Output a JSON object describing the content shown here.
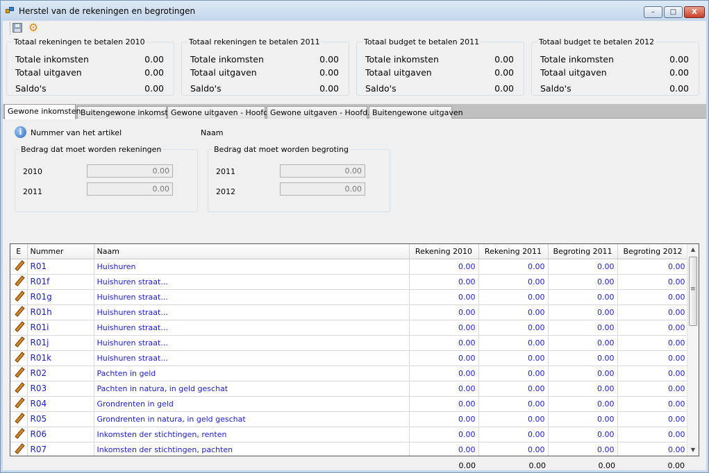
{
  "window": {
    "title": "Herstel van de rekeningen en begrotingen",
    "min": "–",
    "max": "□",
    "close": "X"
  },
  "toolbar": {
    "save_icon": "save-icon",
    "settings_icon": "gear-icon"
  },
  "summaries": [
    {
      "caption": "Totaal rekeningen te betalen 2010",
      "rows": [
        {
          "label": "Totale inkomsten",
          "value": "0.00"
        },
        {
          "label": "Totaal uitgaven",
          "value": "0.00"
        },
        {
          "label": "Saldo's",
          "value": "0.00"
        }
      ]
    },
    {
      "caption": "Totaal rekeningen te betalen 2011",
      "rows": [
        {
          "label": "Totale inkomsten",
          "value": "0.00"
        },
        {
          "label": "Totaal uitgaven",
          "value": "0.00"
        },
        {
          "label": "Saldo's",
          "value": "0.00"
        }
      ]
    },
    {
      "caption": "Totaal budget te betalen 2011",
      "rows": [
        {
          "label": "Totale inkomsten",
          "value": "0.00"
        },
        {
          "label": "Totaal uitgaven",
          "value": "0.00"
        },
        {
          "label": "Saldo's",
          "value": "0.00"
        }
      ]
    },
    {
      "caption": "Totaal budget te betalen 2012",
      "rows": [
        {
          "label": "Totale inkomsten",
          "value": "0.00"
        },
        {
          "label": "Totaal uitgaven",
          "value": "0.00"
        },
        {
          "label": "Saldo's",
          "value": "0.00"
        }
      ]
    }
  ],
  "tabs": [
    {
      "label": "Gewone inkomsten"
    },
    {
      "label": "Buitengewone inkomsten"
    },
    {
      "label": "Gewone uitgaven - Hoofd. I"
    },
    {
      "label": "Gewone uitgaven - Hoofd. II"
    },
    {
      "label": "Buitengewone uitgaven"
    }
  ],
  "detail": {
    "nummer_label": "Nummer van het artikel",
    "naam_label": "Naam",
    "rekeningen": {
      "caption": "Bedrag dat moet worden rekeningen",
      "fields": [
        {
          "year": "2010",
          "value": "0.00"
        },
        {
          "year": "2011",
          "value": "0.00"
        }
      ]
    },
    "begroting": {
      "caption": "Bedrag dat moet worden begroting",
      "fields": [
        {
          "year": "2011",
          "value": "0.00"
        },
        {
          "year": "2012",
          "value": "0.00"
        }
      ]
    }
  },
  "grid": {
    "columns": [
      "E",
      "Nummer",
      "Naam",
      "Rekening 2010",
      "Rekening 2011",
      "Begroting 2011",
      "Begroting 2012"
    ],
    "rows": [
      {
        "nummer": "R01",
        "naam": "Huishuren",
        "r2010": "0.00",
        "r2011": "0.00",
        "b2011": "0.00",
        "b2012": "0.00"
      },
      {
        "nummer": "R01f",
        "naam": "Huishuren straat...",
        "r2010": "0.00",
        "r2011": "0.00",
        "b2011": "0.00",
        "b2012": "0.00"
      },
      {
        "nummer": "R01g",
        "naam": "Huishuren straat...",
        "r2010": "0.00",
        "r2011": "0.00",
        "b2011": "0.00",
        "b2012": "0.00"
      },
      {
        "nummer": "R01h",
        "naam": "Huishuren straat...",
        "r2010": "0.00",
        "r2011": "0.00",
        "b2011": "0.00",
        "b2012": "0.00"
      },
      {
        "nummer": "R01i",
        "naam": "Huishuren straat...",
        "r2010": "0.00",
        "r2011": "0.00",
        "b2011": "0.00",
        "b2012": "0.00"
      },
      {
        "nummer": "R01j",
        "naam": "Huishuren straat...",
        "r2010": "0.00",
        "r2011": "0.00",
        "b2011": "0.00",
        "b2012": "0.00"
      },
      {
        "nummer": "R01k",
        "naam": "Huishuren straat...",
        "r2010": "0.00",
        "r2011": "0.00",
        "b2011": "0.00",
        "b2012": "0.00"
      },
      {
        "nummer": "R02",
        "naam": "Pachten in geld",
        "r2010": "0.00",
        "r2011": "0.00",
        "b2011": "0.00",
        "b2012": "0.00"
      },
      {
        "nummer": "R03",
        "naam": "Pachten in natura, in geld geschat",
        "r2010": "0.00",
        "r2011": "0.00",
        "b2011": "0.00",
        "b2012": "0.00"
      },
      {
        "nummer": "R04",
        "naam": "Grondrenten in geld",
        "r2010": "0.00",
        "r2011": "0.00",
        "b2011": "0.00",
        "b2012": "0.00"
      },
      {
        "nummer": "R05",
        "naam": "Grondrenten in natura, in geld geschat",
        "r2010": "0.00",
        "r2011": "0.00",
        "b2011": "0.00",
        "b2012": "0.00"
      },
      {
        "nummer": "R06",
        "naam": "Inkomsten der stichtingen, renten",
        "r2010": "0.00",
        "r2011": "0.00",
        "b2011": "0.00",
        "b2012": "0.00"
      },
      {
        "nummer": "R07",
        "naam": "Inkomsten der stichtingen, pachten",
        "r2010": "0.00",
        "r2011": "0.00",
        "b2011": "0.00",
        "b2012": "0.00"
      }
    ],
    "totals": {
      "r2010": "0.00",
      "r2011": "0.00",
      "b2011": "0.00",
      "b2012": "0.00"
    },
    "scroll_up": "▲",
    "scroll_down": "▼"
  }
}
